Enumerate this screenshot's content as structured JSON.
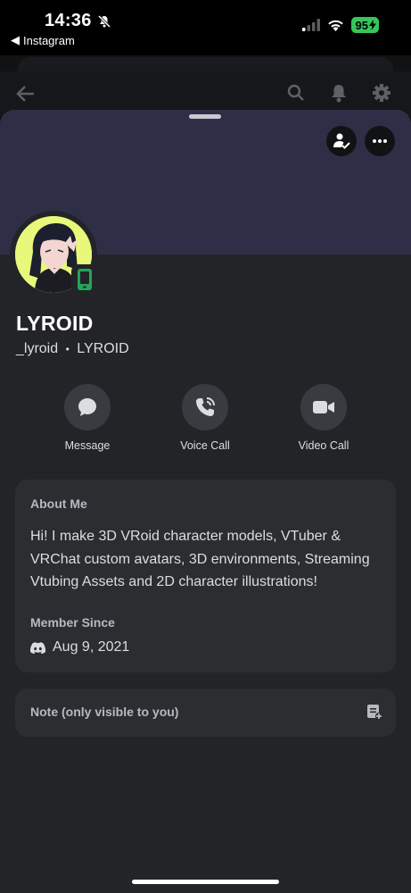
{
  "status_bar": {
    "time": "14:36",
    "back_app": "Instagram",
    "battery": "95"
  },
  "profile": {
    "display_name": "LYROID",
    "username": "_lyroid",
    "separator": "•",
    "pronoun_tag": "LYROID",
    "status": "mobile-online"
  },
  "actions": [
    {
      "label": "Message",
      "icon": "message-icon"
    },
    {
      "label": "Voice Call",
      "icon": "phone-icon"
    },
    {
      "label": "Video Call",
      "icon": "video-icon"
    }
  ],
  "about": {
    "title": "About Me",
    "text": "Hi! I make 3D VRoid character models, VTuber & VRChat custom avatars, 3D environments, Streaming Vtubing Assets and 2D character illustrations!",
    "member_since_title": "Member Since",
    "member_since_date": "Aug 9, 2021"
  },
  "note": {
    "placeholder": "Note (only visible to you)"
  },
  "colors": {
    "banner": "#2e2f47",
    "sheet": "#232428",
    "card": "#2b2d31",
    "online": "#23a55a",
    "battery": "#35c759"
  }
}
